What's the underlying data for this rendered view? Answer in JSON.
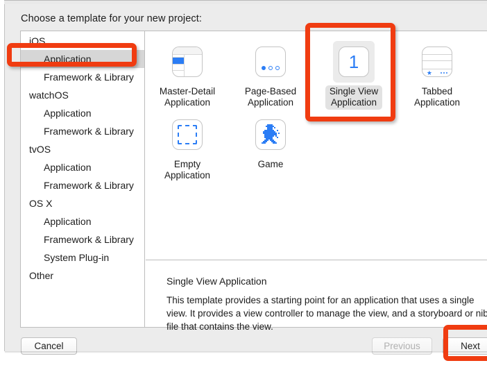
{
  "dialog": {
    "prompt": "Choose a template for your new project:"
  },
  "sidebar": {
    "items": [
      {
        "label": "iOS",
        "level": "group",
        "selected": false
      },
      {
        "label": "Application",
        "level": "child",
        "selected": true
      },
      {
        "label": "Framework & Library",
        "level": "child",
        "selected": false
      },
      {
        "label": "watchOS",
        "level": "group",
        "selected": false
      },
      {
        "label": "Application",
        "level": "child",
        "selected": false
      },
      {
        "label": "Framework & Library",
        "level": "child",
        "selected": false
      },
      {
        "label": "tvOS",
        "level": "group",
        "selected": false
      },
      {
        "label": "Application",
        "level": "child",
        "selected": false
      },
      {
        "label": "Framework & Library",
        "level": "child",
        "selected": false
      },
      {
        "label": "OS X",
        "level": "group",
        "selected": false
      },
      {
        "label": "Application",
        "level": "child",
        "selected": false
      },
      {
        "label": "Framework & Library",
        "level": "child",
        "selected": false
      },
      {
        "label": "System Plug-in",
        "level": "child",
        "selected": false
      },
      {
        "label": "Other",
        "level": "group",
        "selected": false
      }
    ]
  },
  "templates": [
    {
      "label": "Master-Detail\nApplication",
      "icon": "master-detail-icon",
      "selected": false
    },
    {
      "label": "Page-Based\nApplication",
      "icon": "page-based-icon",
      "selected": false
    },
    {
      "label": "Single View\nApplication",
      "icon": "single-view-icon",
      "selected": true
    },
    {
      "label": "Tabbed\nApplication",
      "icon": "tabbed-icon",
      "selected": false
    },
    {
      "label": "Empty\nApplication",
      "icon": "empty-application-icon",
      "selected": false
    },
    {
      "label": "Game",
      "icon": "game-icon",
      "selected": false
    }
  ],
  "description": {
    "title": "Single View Application",
    "body": "This template provides a starting point for an application that uses a single view. It provides a view controller to manage the view, and a storyboard or nib file that contains the view."
  },
  "footer": {
    "cancel": "Cancel",
    "previous": "Previous",
    "next": "Next"
  },
  "colors": {
    "accent_blue": "#2b7df5",
    "annotation_red": "#f03c11",
    "selection_gray": "#d6d6d6",
    "dialog_bg": "#ececec"
  }
}
